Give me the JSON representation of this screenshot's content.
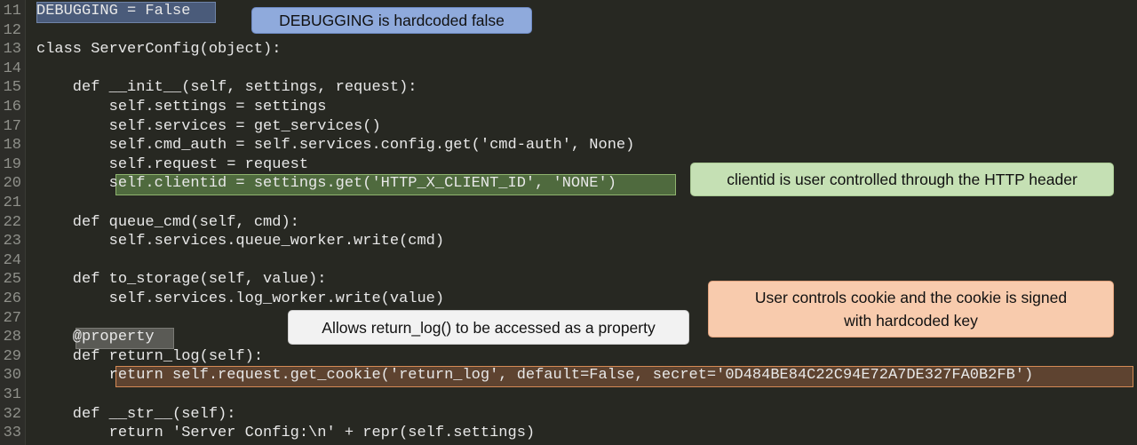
{
  "colors": {
    "background": "#272822",
    "code_text": "#e8e8e8",
    "line_number": "#8f908a",
    "callout_blue": "#8faadc",
    "callout_green": "#c5e0b4",
    "callout_gray": "#f2f2f2",
    "callout_orange": "#f8cbad"
  },
  "lines": [
    {
      "number": "11",
      "text": "DEBUGGING = False"
    },
    {
      "number": "12",
      "text": ""
    },
    {
      "number": "13",
      "text": "class ServerConfig(object):"
    },
    {
      "number": "14",
      "text": ""
    },
    {
      "number": "15",
      "text": "    def __init__(self, settings, request):"
    },
    {
      "number": "16",
      "text": "        self.settings = settings"
    },
    {
      "number": "17",
      "text": "        self.services = get_services()"
    },
    {
      "number": "18",
      "text": "        self.cmd_auth = self.services.config.get('cmd-auth', None)"
    },
    {
      "number": "19",
      "text": "        self.request = request"
    },
    {
      "number": "20",
      "text": "        self.clientid = settings.get('HTTP_X_CLIENT_ID', 'NONE')"
    },
    {
      "number": "21",
      "text": ""
    },
    {
      "number": "22",
      "text": "    def queue_cmd(self, cmd):"
    },
    {
      "number": "23",
      "text": "        self.services.queue_worker.write(cmd)"
    },
    {
      "number": "24",
      "text": ""
    },
    {
      "number": "25",
      "text": "    def to_storage(self, value):"
    },
    {
      "number": "26",
      "text": "        self.services.log_worker.write(value)"
    },
    {
      "number": "27",
      "text": ""
    },
    {
      "number": "28",
      "text": "    @property"
    },
    {
      "number": "29",
      "text": "    def return_log(self):"
    },
    {
      "number": "30",
      "text": "        return self.request.get_cookie('return_log', default=False, secret='0D484BE84C22C94E72A7DE327FA0B2FB')"
    },
    {
      "number": "31",
      "text": ""
    },
    {
      "number": "32",
      "text": "    def __str__(self):"
    },
    {
      "number": "33",
      "text": "        return 'Server Config:\\n' + repr(self.settings)"
    }
  ],
  "callouts": {
    "debugging": "DEBUGGING  is hardcoded false",
    "clientid": "clientid is user  controlled through the HTTP header",
    "property": "Allows return_log() to be accessed  as a property",
    "cookie_line1": "User controls cookie and the cookie is signed",
    "cookie_line2": "with hardcoded key"
  }
}
